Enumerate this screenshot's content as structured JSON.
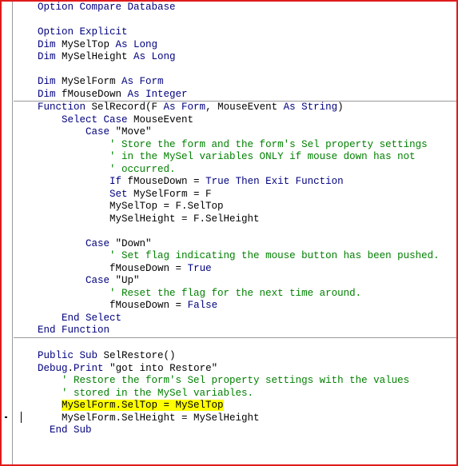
{
  "editor": {
    "name": "vba-code-editor",
    "language": "VBA",
    "colors": {
      "keyword": "#00007f",
      "comment": "#008000",
      "identifier": "#000000",
      "highlight_background": "#ffff00",
      "window_border": "#e01b1b",
      "separator": "#9a9a9a",
      "background": "#ffffff"
    },
    "highlighted_line_number": 32,
    "caret_line_text": "MySelForm.SelTop = MySelTop"
  },
  "lines": [
    {
      "n": 1,
      "sep": false,
      "highlight": false,
      "tokens": [
        {
          "t": "    ",
          "c": "id"
        },
        {
          "t": "Option Compare Database",
          "c": "kw"
        }
      ]
    },
    {
      "n": 2,
      "sep": false,
      "highlight": false,
      "tokens": [
        {
          "t": "",
          "c": "id"
        }
      ]
    },
    {
      "n": 3,
      "sep": false,
      "highlight": false,
      "tokens": [
        {
          "t": "    ",
          "c": "id"
        },
        {
          "t": "Option Explicit",
          "c": "kw"
        }
      ]
    },
    {
      "n": 4,
      "sep": false,
      "highlight": false,
      "tokens": [
        {
          "t": "    ",
          "c": "id"
        },
        {
          "t": "Dim ",
          "c": "kw"
        },
        {
          "t": "MySelTop ",
          "c": "id"
        },
        {
          "t": "As Long",
          "c": "kw"
        }
      ]
    },
    {
      "n": 5,
      "sep": false,
      "highlight": false,
      "tokens": [
        {
          "t": "    ",
          "c": "id"
        },
        {
          "t": "Dim ",
          "c": "kw"
        },
        {
          "t": "MySelHeight ",
          "c": "id"
        },
        {
          "t": "As Long",
          "c": "kw"
        }
      ]
    },
    {
      "n": 6,
      "sep": false,
      "highlight": false,
      "tokens": [
        {
          "t": "",
          "c": "id"
        }
      ]
    },
    {
      "n": 7,
      "sep": false,
      "highlight": false,
      "tokens": [
        {
          "t": "    ",
          "c": "id"
        },
        {
          "t": "Dim ",
          "c": "kw"
        },
        {
          "t": "MySelForm ",
          "c": "id"
        },
        {
          "t": "As Form",
          "c": "kw"
        }
      ]
    },
    {
      "n": 8,
      "sep": false,
      "highlight": false,
      "tokens": [
        {
          "t": "    ",
          "c": "id"
        },
        {
          "t": "Dim ",
          "c": "kw"
        },
        {
          "t": "fMouseDown ",
          "c": "id"
        },
        {
          "t": "As Integer",
          "c": "kw"
        }
      ]
    },
    {
      "n": 9,
      "sep": true,
      "highlight": false,
      "tokens": [
        {
          "t": "    ",
          "c": "id"
        },
        {
          "t": "Function ",
          "c": "kw"
        },
        {
          "t": "SelRecord(F ",
          "c": "id"
        },
        {
          "t": "As Form",
          "c": "kw"
        },
        {
          "t": ", MouseEvent ",
          "c": "id"
        },
        {
          "t": "As String",
          "c": "kw"
        },
        {
          "t": ")",
          "c": "id"
        }
      ]
    },
    {
      "n": 10,
      "sep": false,
      "highlight": false,
      "tokens": [
        {
          "t": "        ",
          "c": "id"
        },
        {
          "t": "Select Case ",
          "c": "kw"
        },
        {
          "t": "MouseEvent",
          "c": "id"
        }
      ]
    },
    {
      "n": 11,
      "sep": false,
      "highlight": false,
      "tokens": [
        {
          "t": "            ",
          "c": "id"
        },
        {
          "t": "Case ",
          "c": "kw"
        },
        {
          "t": "\"Move\"",
          "c": "id"
        }
      ]
    },
    {
      "n": 12,
      "sep": false,
      "highlight": false,
      "tokens": [
        {
          "t": "                ",
          "c": "id"
        },
        {
          "t": "' Store the form and the form's Sel property settings",
          "c": "cm"
        }
      ]
    },
    {
      "n": 13,
      "sep": false,
      "highlight": false,
      "tokens": [
        {
          "t": "                ",
          "c": "id"
        },
        {
          "t": "' in the MySel variables ONLY if mouse down has not",
          "c": "cm"
        }
      ]
    },
    {
      "n": 14,
      "sep": false,
      "highlight": false,
      "tokens": [
        {
          "t": "                ",
          "c": "id"
        },
        {
          "t": "' occurred.",
          "c": "cm"
        }
      ]
    },
    {
      "n": 15,
      "sep": false,
      "highlight": false,
      "tokens": [
        {
          "t": "                ",
          "c": "id"
        },
        {
          "t": "If ",
          "c": "kw"
        },
        {
          "t": "fMouseDown = ",
          "c": "id"
        },
        {
          "t": "True Then Exit Function",
          "c": "kw"
        }
      ]
    },
    {
      "n": 16,
      "sep": false,
      "highlight": false,
      "tokens": [
        {
          "t": "                ",
          "c": "id"
        },
        {
          "t": "Set ",
          "c": "kw"
        },
        {
          "t": "MySelForm = F",
          "c": "id"
        }
      ]
    },
    {
      "n": 17,
      "sep": false,
      "highlight": false,
      "tokens": [
        {
          "t": "                ",
          "c": "id"
        },
        {
          "t": "MySelTop = F.SelTop",
          "c": "id"
        }
      ]
    },
    {
      "n": 18,
      "sep": false,
      "highlight": false,
      "tokens": [
        {
          "t": "                ",
          "c": "id"
        },
        {
          "t": "MySelHeight = F.SelHeight",
          "c": "id"
        }
      ]
    },
    {
      "n": 19,
      "sep": false,
      "highlight": false,
      "tokens": [
        {
          "t": "",
          "c": "id"
        }
      ]
    },
    {
      "n": 20,
      "sep": false,
      "highlight": false,
      "tokens": [
        {
          "t": "            ",
          "c": "id"
        },
        {
          "t": "Case ",
          "c": "kw"
        },
        {
          "t": "\"Down\"",
          "c": "id"
        }
      ]
    },
    {
      "n": 21,
      "sep": false,
      "highlight": false,
      "tokens": [
        {
          "t": "                ",
          "c": "id"
        },
        {
          "t": "' Set flag indicating the mouse button has been pushed.",
          "c": "cm"
        }
      ]
    },
    {
      "n": 22,
      "sep": false,
      "highlight": false,
      "tokens": [
        {
          "t": "                ",
          "c": "id"
        },
        {
          "t": "fMouseDown = ",
          "c": "id"
        },
        {
          "t": "True",
          "c": "kw"
        }
      ]
    },
    {
      "n": 23,
      "sep": false,
      "highlight": false,
      "tokens": [
        {
          "t": "            ",
          "c": "id"
        },
        {
          "t": "Case ",
          "c": "kw"
        },
        {
          "t": "\"Up\"",
          "c": "id"
        }
      ]
    },
    {
      "n": 24,
      "sep": false,
      "highlight": false,
      "tokens": [
        {
          "t": "                ",
          "c": "id"
        },
        {
          "t": "' Reset the flag for the next time around.",
          "c": "cm"
        }
      ]
    },
    {
      "n": 25,
      "sep": false,
      "highlight": false,
      "tokens": [
        {
          "t": "                ",
          "c": "id"
        },
        {
          "t": "fMouseDown = ",
          "c": "id"
        },
        {
          "t": "False",
          "c": "kw"
        }
      ]
    },
    {
      "n": 26,
      "sep": false,
      "highlight": false,
      "tokens": [
        {
          "t": "        ",
          "c": "id"
        },
        {
          "t": "End Select",
          "c": "kw"
        }
      ]
    },
    {
      "n": 27,
      "sep": false,
      "highlight": false,
      "tokens": [
        {
          "t": "    ",
          "c": "id"
        },
        {
          "t": "End Function",
          "c": "kw"
        }
      ]
    },
    {
      "n": 28,
      "sep": true,
      "highlight": false,
      "tokens": [
        {
          "t": "",
          "c": "id"
        }
      ]
    },
    {
      "n": 29,
      "sep": false,
      "highlight": false,
      "tokens": [
        {
          "t": "    ",
          "c": "id"
        },
        {
          "t": "Public Sub ",
          "c": "kw"
        },
        {
          "t": "SelRestore()",
          "c": "id"
        }
      ]
    },
    {
      "n": 30,
      "sep": false,
      "highlight": false,
      "tokens": [
        {
          "t": "    ",
          "c": "id"
        },
        {
          "t": "Debug",
          "c": "kw"
        },
        {
          "t": ".",
          "c": "id"
        },
        {
          "t": "Print ",
          "c": "kw"
        },
        {
          "t": "\"got into Restore\"",
          "c": "id"
        }
      ]
    },
    {
      "n": 31,
      "sep": false,
      "highlight": false,
      "tokens": [
        {
          "t": "        ",
          "c": "id"
        },
        {
          "t": "' Restore the form's Sel property settings with the values",
          "c": "cm"
        }
      ]
    },
    {
      "n": 32,
      "sep": false,
      "highlight": false,
      "tokens": [
        {
          "t": "        ",
          "c": "id"
        },
        {
          "t": "' stored in the MySel variables.",
          "c": "cm"
        }
      ]
    },
    {
      "n": 33,
      "sep": false,
      "highlight": true,
      "tokens": [
        {
          "t": "        ",
          "c": "id"
        },
        {
          "t": "MySelForm.SelTop = MySelTop",
          "c": "hl"
        }
      ]
    },
    {
      "n": 34,
      "sep": false,
      "highlight": false,
      "tokens": [
        {
          "t": "        ",
          "c": "id"
        },
        {
          "t": "MySelForm.SelHeight = MySelHeight",
          "c": "id"
        }
      ]
    },
    {
      "n": 35,
      "sep": false,
      "highlight": false,
      "tokens": [
        {
          "t": "      ",
          "c": "id"
        },
        {
          "t": "End Sub",
          "c": "kw"
        }
      ]
    }
  ]
}
